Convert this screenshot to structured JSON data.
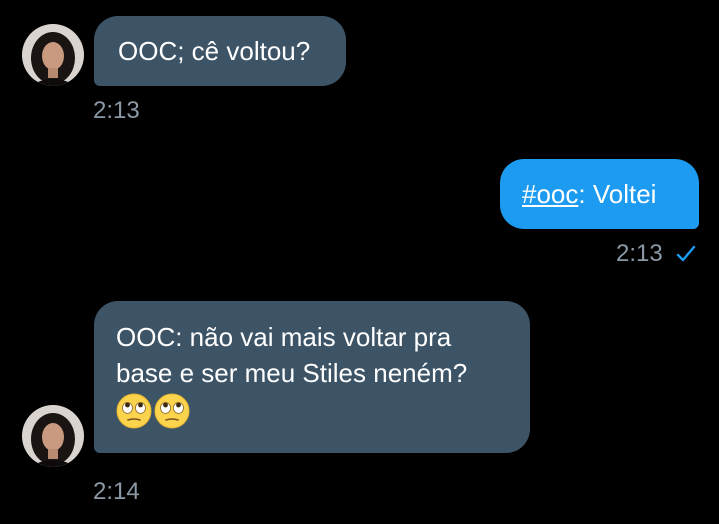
{
  "messages": [
    {
      "direction": "incoming",
      "text": "OOC; cê voltou?",
      "time": "2:13"
    },
    {
      "direction": "outgoing",
      "hashtag": "#ooc",
      "text_after_hashtag": ": Voltei",
      "time": "2:13",
      "status_icon": "check-icon"
    },
    {
      "direction": "incoming",
      "line1": "OOC: não vai mais voltar pra",
      "line2": "base e ser meu Stiles neném?",
      "emojis": [
        "face-with-rolling-eyes",
        "face-with-rolling-eyes"
      ],
      "time": "2:14"
    }
  ],
  "colors": {
    "background": "#000000",
    "incoming_bubble": "#3d5467",
    "outgoing_bubble": "#1d9bf0",
    "timestamp": "#8b98a5",
    "read_check": "#1d9bf0"
  }
}
